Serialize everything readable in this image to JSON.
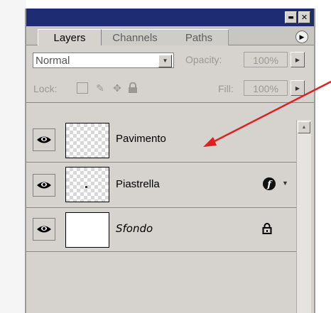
{
  "window": {
    "minimize_glyph": "▬",
    "close_glyph": "✕"
  },
  "tabs": [
    {
      "label": "Layers",
      "active": true
    },
    {
      "label": "Channels",
      "active": false
    },
    {
      "label": "Paths",
      "active": false
    }
  ],
  "options_row": {
    "blend_mode": "Normal",
    "opacity_label": "Opacity:",
    "opacity_value": "100%"
  },
  "lock_row": {
    "lock_label": "Lock:",
    "fill_label": "Fill:",
    "fill_value": "100%",
    "icons": [
      "transparency-lock-icon",
      "brush-lock-icon",
      "move-lock-icon",
      "padlock-icon"
    ]
  },
  "layers": [
    {
      "name": "Pavimento",
      "visible": true,
      "thumbnail": "transparent",
      "badge": null
    },
    {
      "name": "Piastrella",
      "visible": true,
      "thumbnail": "transparent-dot",
      "badge": "layer-style-icon"
    },
    {
      "name": "Sfondo",
      "visible": true,
      "thumbnail": "white",
      "badge": "padlock-icon"
    }
  ],
  "annotation": {
    "color": "#e02020"
  },
  "colors": {
    "titlebar": "#1e2c74",
    "panel": "#d6d3ce"
  }
}
